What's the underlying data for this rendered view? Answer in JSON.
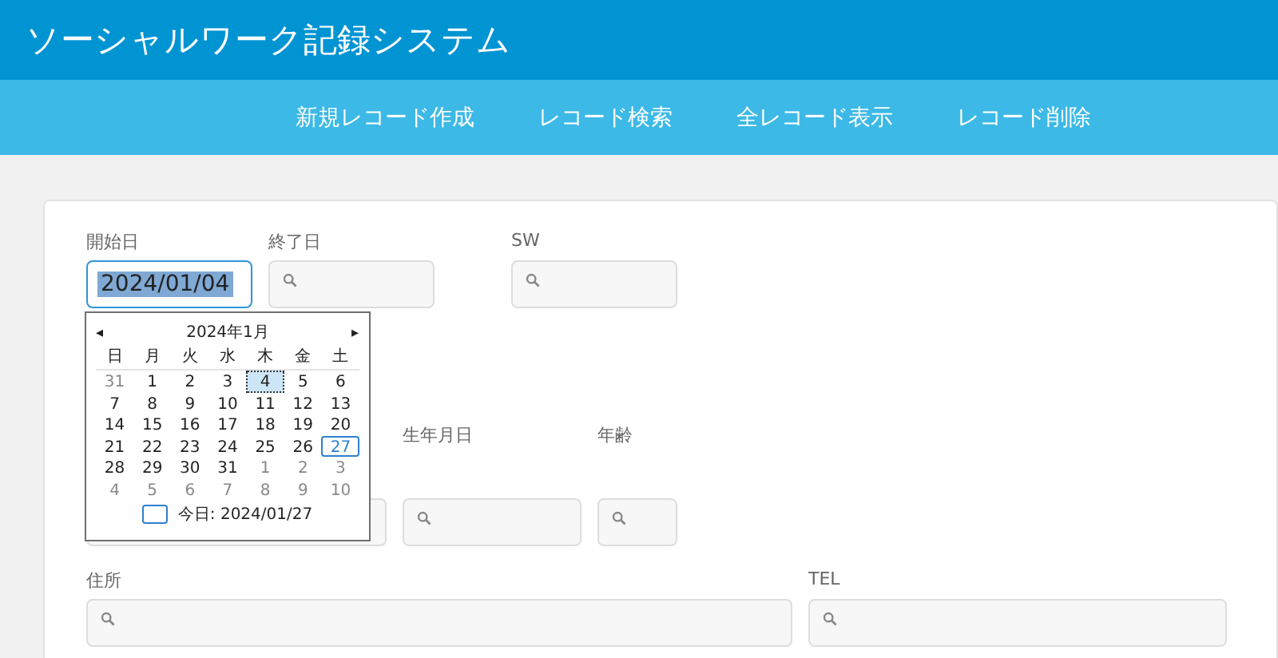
{
  "app_title": "ソーシャルワーク記録システム",
  "nav": [
    {
      "label": "新規レコード作成"
    },
    {
      "label": "レコード検索"
    },
    {
      "label": "全レコード表示"
    },
    {
      "label": "レコード削除"
    }
  ],
  "rows": [
    [
      {
        "label": "開始日",
        "value": "2024/01/04",
        "focused": true
      },
      {
        "label": "終了日",
        "focused": false
      },
      {
        "label": "SW",
        "focused": false
      }
    ],
    [
      {
        "focused": false
      },
      {
        "label": "生年月日",
        "focused": false
      },
      {
        "label": "年齢",
        "focused": false
      }
    ],
    [
      {
        "label": "住所",
        "focused": false
      },
      {
        "label": "TEL",
        "focused": false
      }
    ]
  ],
  "calendar": {
    "month": "2024年1月",
    "prev": "◂",
    "next": "▸",
    "weekdays": [
      "日",
      "月",
      "火",
      "水",
      "木",
      "金",
      "土"
    ],
    "weeks": [
      [
        {
          "d": "31",
          "other": true,
          "selected": false,
          "today": false
        },
        {
          "d": "1",
          "other": false,
          "selected": false,
          "today": false
        },
        {
          "d": "2",
          "other": false,
          "selected": false,
          "today": false
        },
        {
          "d": "3",
          "other": false,
          "selected": false,
          "today": false
        },
        {
          "d": "4",
          "other": false,
          "selected": true,
          "today": false
        },
        {
          "d": "5",
          "other": false,
          "selected": false,
          "today": false
        },
        {
          "d": "6",
          "other": false,
          "selected": false,
          "today": false
        }
      ],
      [
        {
          "d": "7",
          "other": false,
          "selected": false,
          "today": false
        },
        {
          "d": "8",
          "other": false,
          "selected": false,
          "today": false
        },
        {
          "d": "9",
          "other": false,
          "selected": false,
          "today": false
        },
        {
          "d": "10",
          "other": false,
          "selected": false,
          "today": false
        },
        {
          "d": "11",
          "other": false,
          "selected": false,
          "today": false
        },
        {
          "d": "12",
          "other": false,
          "selected": false,
          "today": false
        },
        {
          "d": "13",
          "other": false,
          "selected": false,
          "today": false
        }
      ],
      [
        {
          "d": "14",
          "other": false,
          "selected": false,
          "today": false
        },
        {
          "d": "15",
          "other": false,
          "selected": false,
          "today": false
        },
        {
          "d": "16",
          "other": false,
          "selected": false,
          "today": false
        },
        {
          "d": "17",
          "other": false,
          "selected": false,
          "today": false
        },
        {
          "d": "18",
          "other": false,
          "selected": false,
          "today": false
        },
        {
          "d": "19",
          "other": false,
          "selected": false,
          "today": false
        },
        {
          "d": "20",
          "other": false,
          "selected": false,
          "today": false
        }
      ],
      [
        {
          "d": "21",
          "other": false,
          "selected": false,
          "today": false
        },
        {
          "d": "22",
          "other": false,
          "selected": false,
          "today": false
        },
        {
          "d": "23",
          "other": false,
          "selected": false,
          "today": false
        },
        {
          "d": "24",
          "other": false,
          "selected": false,
          "today": false
        },
        {
          "d": "25",
          "other": false,
          "selected": false,
          "today": false
        },
        {
          "d": "26",
          "other": false,
          "selected": false,
          "today": false
        },
        {
          "d": "27",
          "other": false,
          "selected": false,
          "today": true
        }
      ],
      [
        {
          "d": "28",
          "other": false,
          "selected": false,
          "today": false
        },
        {
          "d": "29",
          "other": false,
          "selected": false,
          "today": false
        },
        {
          "d": "30",
          "other": false,
          "selected": false,
          "today": false
        },
        {
          "d": "31",
          "other": false,
          "selected": false,
          "today": false
        },
        {
          "d": "1",
          "other": true,
          "selected": false,
          "today": false
        },
        {
          "d": "2",
          "other": true,
          "selected": false,
          "today": false
        },
        {
          "d": "3",
          "other": true,
          "selected": false,
          "today": false
        }
      ],
      [
        {
          "d": "4",
          "other": true,
          "selected": false,
          "today": false
        },
        {
          "d": "5",
          "other": true,
          "selected": false,
          "today": false
        },
        {
          "d": "6",
          "other": true,
          "selected": false,
          "today": false
        },
        {
          "d": "7",
          "other": true,
          "selected": false,
          "today": false
        },
        {
          "d": "8",
          "other": true,
          "selected": false,
          "today": false
        },
        {
          "d": "9",
          "other": true,
          "selected": false,
          "today": false
        },
        {
          "d": "10",
          "other": true,
          "selected": false,
          "today": false
        }
      ]
    ],
    "today_label": "今日: 2024/01/27"
  }
}
